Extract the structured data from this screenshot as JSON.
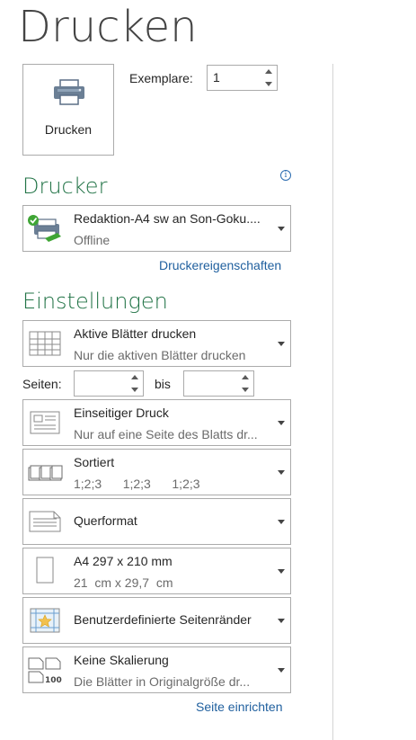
{
  "page": {
    "title": "Drucken"
  },
  "print_button": {
    "label": "Drucken",
    "icon": "printer-icon"
  },
  "copies": {
    "label": "Exemplare:",
    "value": "1"
  },
  "printer": {
    "heading": "Drucker",
    "name": "Redaktion-A4 sw an Son-Goku....",
    "status": "Offline",
    "icon": "printer-ready-icon",
    "properties_link": "Druckereigenschaften",
    "info_icon": "i"
  },
  "settings": {
    "heading": "Einstellungen",
    "items": [
      {
        "title": "Aktive Blätter drucken",
        "subtitle": "Nur die aktiven Blätter drucken",
        "icon": "sheet-grid-icon"
      },
      {
        "title": "Einseitiger Druck",
        "subtitle": "Nur auf eine Seite des Blatts dr...",
        "icon": "single-sided-icon"
      },
      {
        "title": "Sortiert",
        "subtitle": "1;2;3    1;2;3    1;2;3",
        "icon": "collated-icon"
      },
      {
        "title": "Querformat",
        "subtitle": "",
        "icon": "landscape-icon"
      },
      {
        "title": "A4 297 x 210 mm",
        "subtitle": "21  cm x 29,7  cm",
        "icon": "paper-size-icon"
      },
      {
        "title": "Benutzerdefinierte Seitenränder",
        "subtitle": "",
        "icon": "margins-icon"
      },
      {
        "title": "Keine Skalierung",
        "subtitle": "Die Blätter in Originalgröße dr...",
        "icon": "no-scaling-icon"
      }
    ],
    "pages": {
      "label": "Seiten:",
      "from_value": "",
      "to_label": "bis",
      "to_value": ""
    },
    "page_setup_link": "Seite einrichten"
  },
  "colors": {
    "accent": "#217346",
    "link": "#1f5f9e",
    "border": "#ababab"
  }
}
